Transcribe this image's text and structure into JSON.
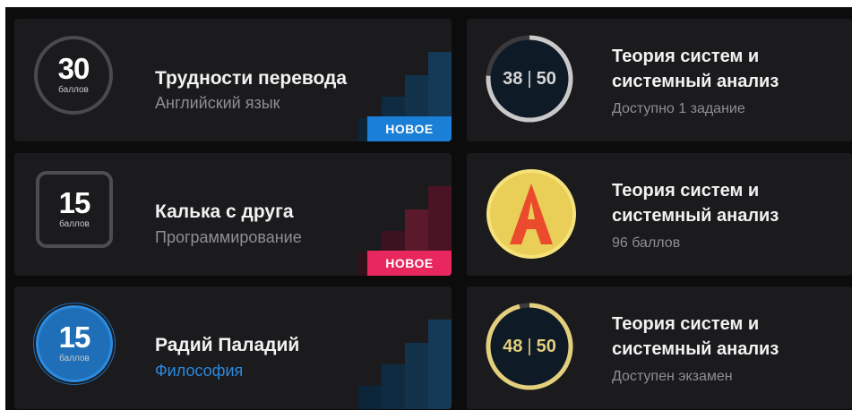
{
  "cards_left": [
    {
      "points": "30",
      "unit": "баллов",
      "title": "Трудности перевода",
      "subject": "Английский язык",
      "badge": "НОВОЕ"
    },
    {
      "points": "15",
      "unit": "баллов",
      "title": "Калька с друга",
      "subject": "Программирование",
      "badge": "НОВОЕ"
    },
    {
      "points": "15",
      "unit": "баллов",
      "title": "Радий Паладий",
      "subject": "Философия"
    }
  ],
  "cards_right": [
    {
      "progress_done": "38",
      "progress_sep": "|",
      "progress_total": "50",
      "title": "Теория систем и системный анализ",
      "status": "Доступно 1 задание"
    },
    {
      "avatar_letter_icon": "letter-a-icon",
      "title": "Теория систем и системный анализ",
      "status": "96 баллов"
    },
    {
      "progress_done": "48",
      "progress_sep": "|",
      "progress_total": "50",
      "title": "Теория систем и системный анализ",
      "status": "Доступен экзамен"
    }
  ],
  "colors": {
    "background": "#0c0c0d",
    "card": "#1b1b1d",
    "badge_blue": "#1a7fd6",
    "badge_pink": "#e8275e",
    "link_blue": "#2a88df",
    "gold": "#e3cf7c"
  }
}
